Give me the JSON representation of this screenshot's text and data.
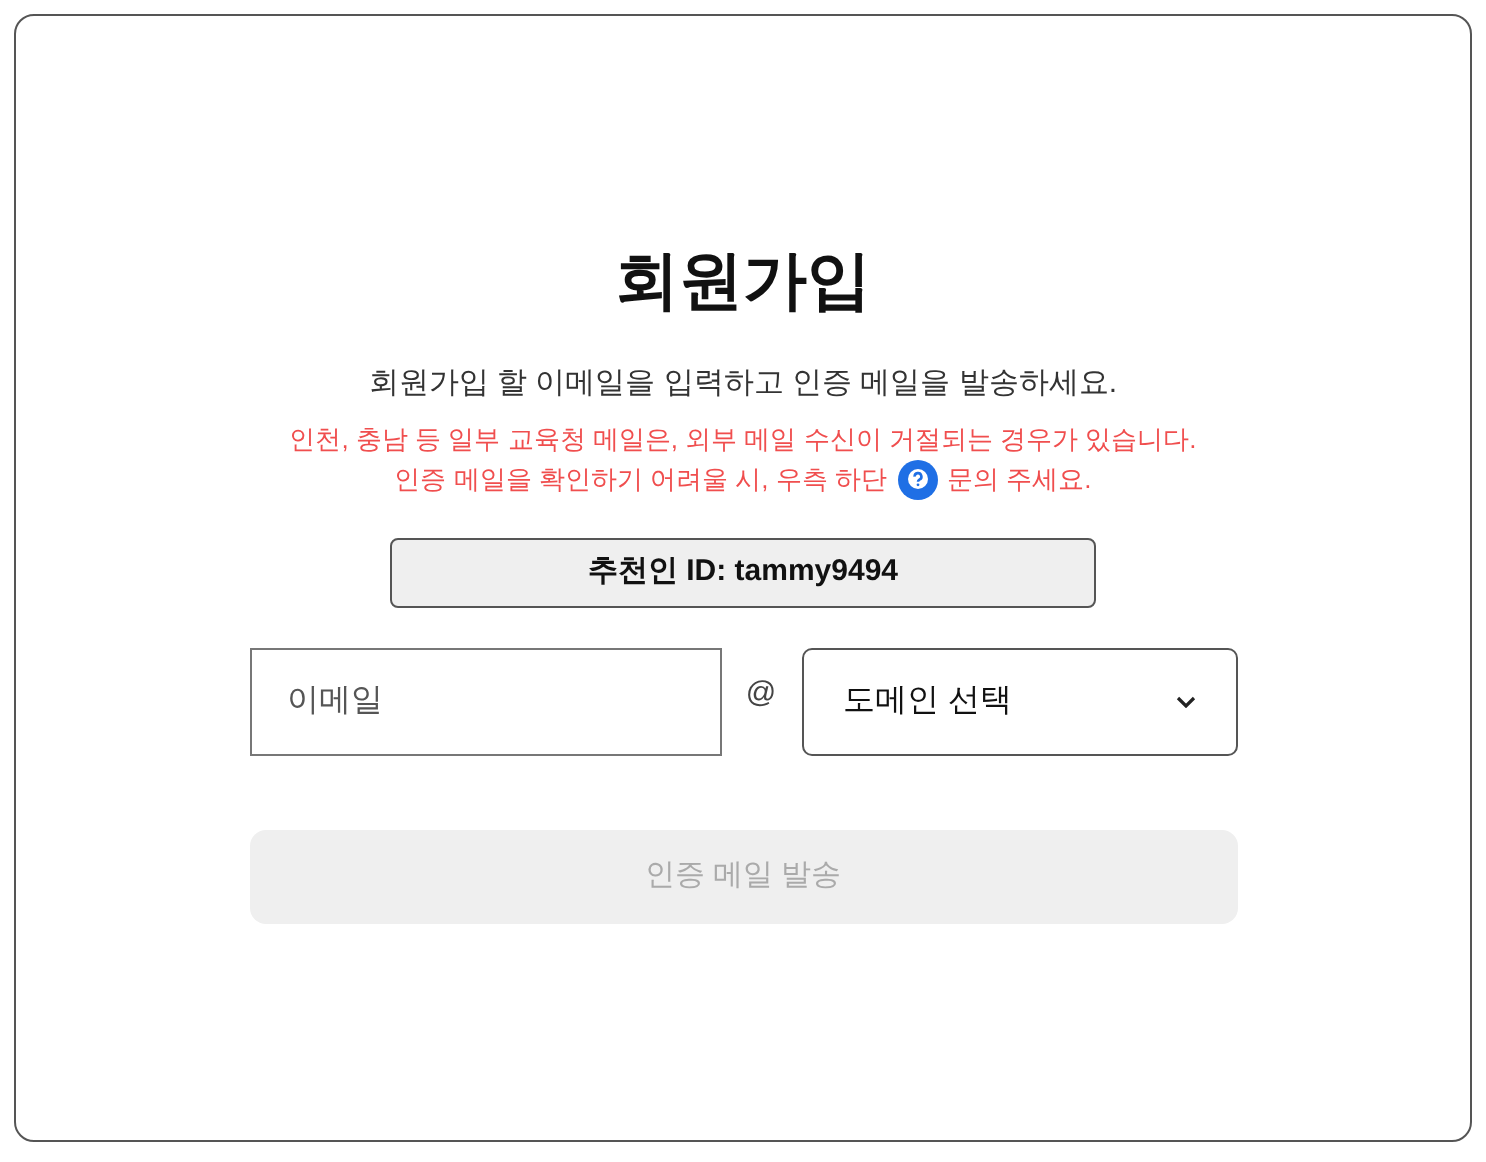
{
  "title": "회원가입",
  "subtitle": "회원가입 할 이메일을 입력하고 인증 메일을 발송하세요.",
  "warning": {
    "line_1": "인천, 충남 등 일부 교육청 메일은, 외부 메일 수신이 거절되는 경우가 있습니다.",
    "line_2_before": "인증 메일을 확인하기 어려울 시, 우측 하단",
    "line_2_after": "문의 주세요."
  },
  "referrer": "추천인 ID: tammy9494",
  "email": {
    "placeholder": "이메일"
  },
  "at": "@",
  "domain": {
    "value": "도메인 선택"
  },
  "send_button": {
    "label": "인증 메일 발송",
    "disabled": true
  }
}
